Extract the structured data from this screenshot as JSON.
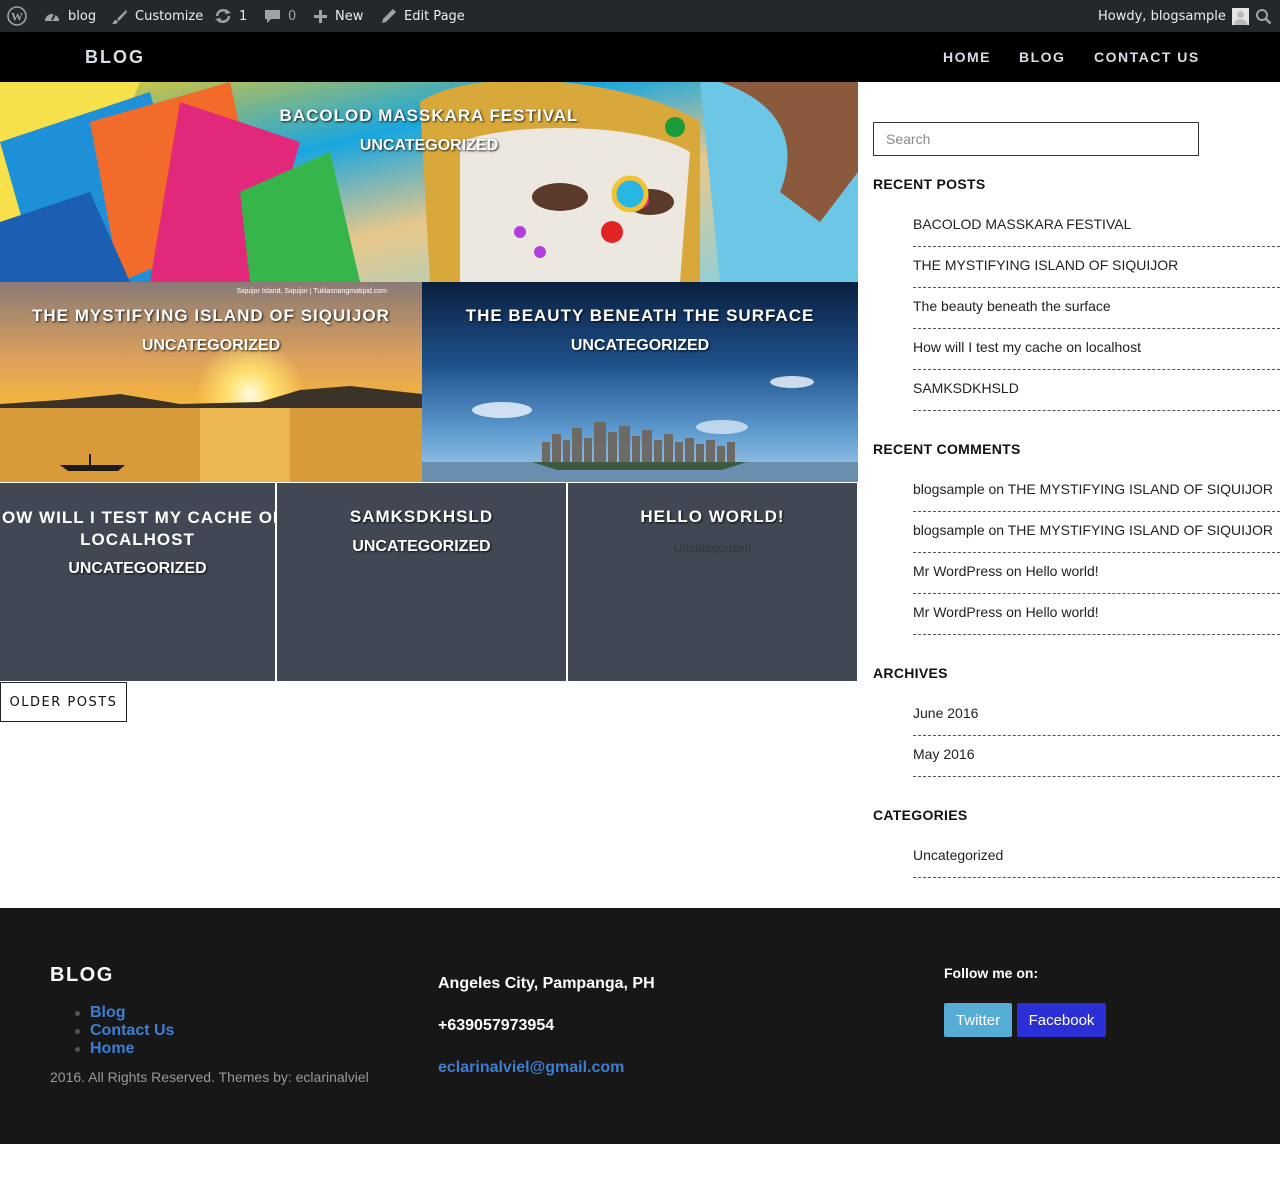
{
  "adminbar": {
    "site": "blog",
    "customize": "Customize",
    "updates": "1",
    "comments": "0",
    "new": "New",
    "edit": "Edit Page",
    "howdy": "Howdy, blogsample"
  },
  "header": {
    "title": "BLOG",
    "nav": [
      "HOME",
      "BLOG",
      "CONTACT US"
    ]
  },
  "posts": [
    {
      "title": "BACOLOD MASSKARA FESTIVAL",
      "category": "UNCATEGORIZED"
    },
    {
      "title": "THE MYSTIFYING ISLAND OF SIQUIJOR",
      "category": "UNCATEGORIZED",
      "watermark": "Siquijor Island, Siquijor | Tuklasnangmatipid.com"
    },
    {
      "title": "THE BEAUTY BENEATH THE SURFACE",
      "category": "UNCATEGORIZED"
    },
    {
      "title": "HOW WILL I TEST MY CACHE ON LOCALHOST",
      "category": "UNCATEGORIZED"
    },
    {
      "title": "SAMKSDKHSLD",
      "category": "UNCATEGORIZED"
    },
    {
      "title": "HELLO WORLD!",
      "category": "Uncategorized"
    }
  ],
  "older_posts": "OLDER POSTS",
  "sidebar": {
    "search_placeholder": "Search",
    "recent_posts_title": "RECENT POSTS",
    "recent_posts": [
      "BACOLOD MASSKARA FESTIVAL",
      "THE MYSTIFYING ISLAND OF SIQUIJOR",
      "The beauty beneath the surface",
      "How will I test my cache on localhost",
      "SAMKSDKHSLD"
    ],
    "recent_comments_title": "RECENT COMMENTS",
    "recent_comments": [
      {
        "author": "blogsample",
        "on": "on",
        "post": "THE MYSTIFYING ISLAND OF SIQUIJOR"
      },
      {
        "author": "blogsample",
        "on": "on",
        "post": "THE MYSTIFYING ISLAND OF SIQUIJOR"
      },
      {
        "author": "Mr WordPress",
        "on": "on",
        "post": "Hello world!"
      },
      {
        "author": "Mr WordPress",
        "on": "on",
        "post": "Hello world!"
      }
    ],
    "archives_title": "ARCHIVES",
    "archives": [
      "June 2016",
      "May 2016"
    ],
    "categories_title": "CATEGORIES",
    "categories": [
      "Uncategorized"
    ]
  },
  "footer": {
    "title": "BLOG",
    "links": [
      "Blog",
      "Contact Us",
      "Home"
    ],
    "copyright": "2016. All Rights Reserved. Themes by: eclarinalviel",
    "address": "Angeles City, Pampanga, PH",
    "phone": "+639057973954",
    "email": "eclarinalviel@gmail.com",
    "follow": "Follow me on:",
    "twitter": "Twitter",
    "facebook": "Facebook"
  },
  "colors": {
    "adminbar": "#23282d",
    "header": "#000000",
    "tile_grey": "#424853",
    "footer": "#171717",
    "link_blue": "#3d7ed3",
    "twitter": "#55acd4",
    "facebook": "#2a2fd6"
  }
}
